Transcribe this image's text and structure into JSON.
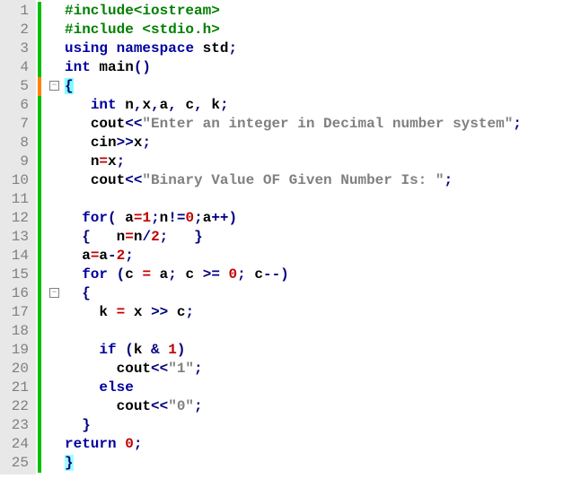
{
  "lines": {
    "count": 25
  },
  "code": {
    "l1": {
      "pre": "",
      "pp": "#include<iostream>"
    },
    "l2": {
      "pre": "",
      "pp": "#include <stdio.h>"
    },
    "l3": {
      "pre": "",
      "kw1": "using",
      "kw2": "namespace",
      "id": "std",
      "sc": ";"
    },
    "l4": {
      "pre": "",
      "kw1": "int",
      "id": "main",
      "paren": "()"
    },
    "l5": {
      "pre": "",
      "br": "{"
    },
    "l6": {
      "pre": "   ",
      "kw": "int",
      "ids": "n",
      "c1": ",",
      "id2": "x",
      "c2": ",",
      "id3": "a",
      "c3": ",",
      "sp3": " ",
      "id4": "c",
      "c4": ",",
      "sp4": " ",
      "id5": "k",
      "sc": ";"
    },
    "l7": {
      "pre": "   ",
      "id": "cout",
      "op": "<<",
      "str": "\"Enter an integer in Decimal number system\"",
      "sc": ";"
    },
    "l8": {
      "pre": "   ",
      "id": "cin",
      "op": ">>",
      "id2": "x",
      "sc": ";"
    },
    "l9": {
      "pre": "   ",
      "id": "n",
      "eq": "=",
      "id2": "x",
      "sc": ";"
    },
    "l10": {
      "pre": "   ",
      "id": "cout",
      "op": "<<",
      "str": "\"Binary Value OF Given Number Is: \"",
      "sc": ";"
    },
    "l12": {
      "pre": "  ",
      "kw": "for",
      "lp": "(",
      "sp": " ",
      "id": "a",
      "eq": "=",
      "n1": "1",
      "sc1": ";",
      "id2": "n",
      "ne": "!=",
      "n2": "0",
      "sc2": ";",
      "id3": "a",
      "inc": "++",
      "rp": ")"
    },
    "l13": {
      "pre": "  ",
      "lb": "{",
      "sp": "   ",
      "id": "n",
      "eq": "=",
      "id2": "n",
      "div": "/",
      "n": "2",
      "sc": ";",
      "sp2": "   ",
      "rb": "}"
    },
    "l14": {
      "pre": "  ",
      "id": "a",
      "eq": "=",
      "id2": "a",
      "mn": "-",
      "n": "2",
      "sc": ";"
    },
    "l15": {
      "pre": "  ",
      "kw": "for",
      "sp": " ",
      "lp": "(",
      "id": "c",
      "sp2": " ",
      "eq": "=",
      "sp3": " ",
      "id2": "a",
      "sc1": ";",
      "sp4": " ",
      "id3": "c",
      "sp5": " ",
      "ge": ">=",
      "sp6": " ",
      "n": "0",
      "sc2": ";",
      "sp7": " ",
      "id4": "c",
      "dec": "--",
      "rp": ")"
    },
    "l16": {
      "pre": "  ",
      "lb": "{"
    },
    "l17": {
      "pre": "    ",
      "id": "k",
      "sp": " ",
      "eq": "=",
      "sp2": " ",
      "id2": "x",
      "sp3": " ",
      "sh": ">>",
      "sp4": " ",
      "id3": "c",
      "sc": ";"
    },
    "l19": {
      "pre": "    ",
      "kw": "if",
      "sp": " ",
      "lp": "(",
      "id": "k",
      "sp2": " ",
      "amp": "&",
      "sp3": " ",
      "n": "1",
      "rp": ")"
    },
    "l20": {
      "pre": "      ",
      "id": "cout",
      "op": "<<",
      "str": "\"1\"",
      "sc": ";"
    },
    "l21": {
      "pre": "    ",
      "kw": "else"
    },
    "l22": {
      "pre": "      ",
      "id": "cout",
      "op": "<<",
      "str": "\"0\"",
      "sc": ";"
    },
    "l23": {
      "pre": "  ",
      "rb": "}"
    },
    "l24": {
      "pre": "",
      "kw": "return",
      "sp": " ",
      "n": "0",
      "sc": ";"
    },
    "l25": {
      "pre": "",
      "rb": "}"
    }
  }
}
